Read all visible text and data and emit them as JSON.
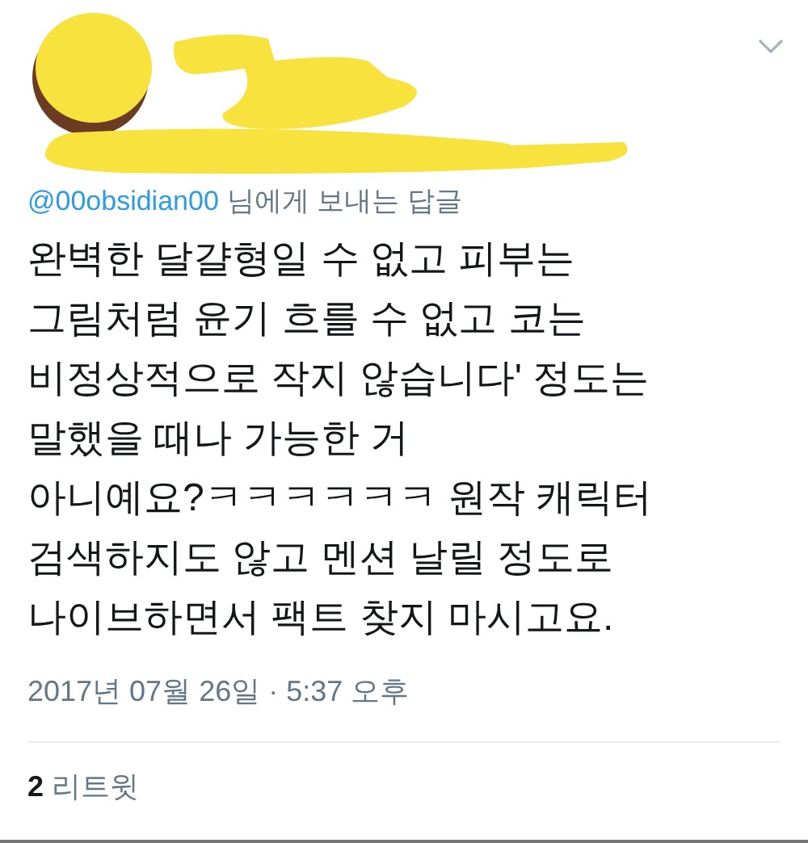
{
  "reply_to": {
    "handle": "@00obsidian00",
    "label": "님에게 보내는 답글"
  },
  "tweet_text": "완벽한 달걀형일 수 없고 피부는\n그림처럼 윤기 흐를 수 없고 코는\n비정상적으로 작지 않습니다' 정도는\n말했을 때나 가능한 거\n아니예요?ㅋㅋㅋㅋㅋㅋ 원작 캐릭터\n검색하지도 않고 멘션 날릴 정도로\n나이브하면서 팩트 찾지 마시고요.",
  "timestamp": "2017년 07월 26일 · 5:37 오후",
  "retweets": {
    "count": "2",
    "label": "리트윗"
  }
}
